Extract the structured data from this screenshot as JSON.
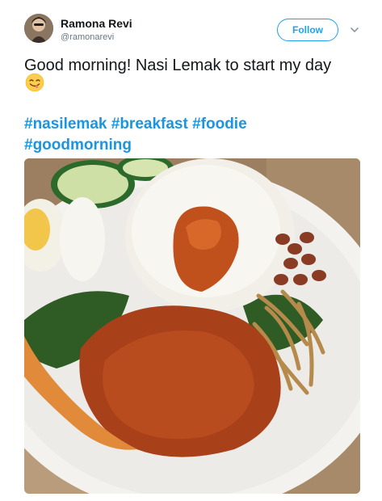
{
  "user": {
    "name": "Ramona Revi",
    "handle": "@ramonarevi"
  },
  "follow_label": "Follow",
  "tweet": {
    "text": "Good morning! Nasi Lemak to start my day",
    "emoji": "face-savoring-food-emoji",
    "hashtags": [
      "#nasilemak",
      "#breakfast",
      "#foodie",
      "#goodmorning"
    ]
  },
  "colors": {
    "accent": "#1da1f2",
    "hashtag": "#1b95e0",
    "handle": "#657786",
    "text": "#14171a"
  },
  "icons": {
    "menu": "chevron-down-icon"
  }
}
